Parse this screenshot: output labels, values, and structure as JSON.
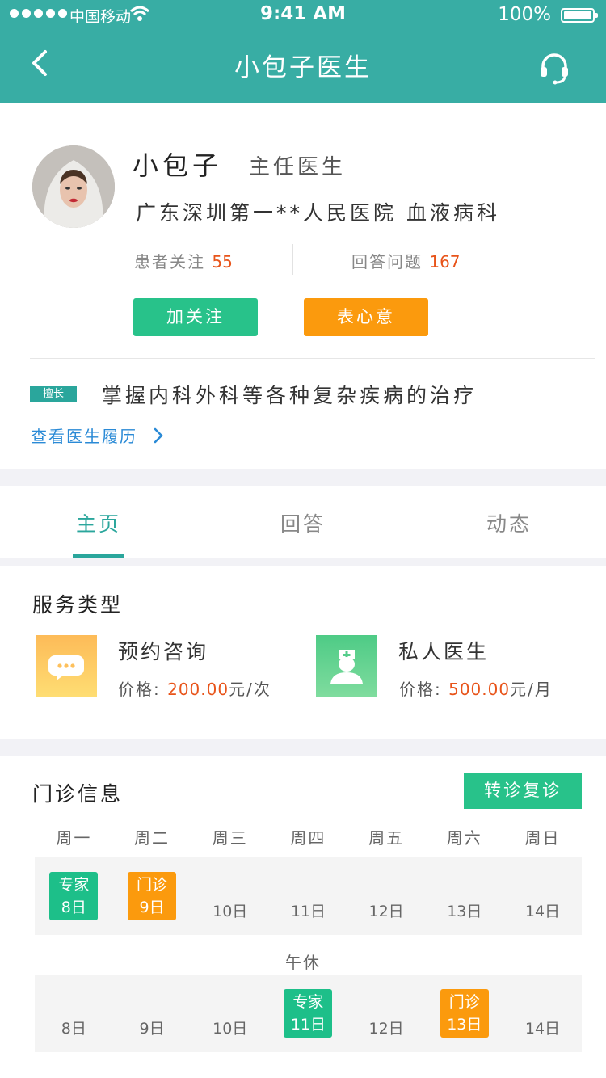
{
  "status_bar": {
    "carrier": "中国移动",
    "time": "9:41 AM",
    "battery": "100%"
  },
  "header": {
    "title": "小包子医生"
  },
  "doctor": {
    "name": "小包子",
    "title": "主任医生",
    "hospital": "广东深圳第一**人民医院  血液病科",
    "followers_label": "患者关注",
    "followers": "55",
    "answers_label": "回答问题",
    "answers": "167",
    "follow_button": "加关注",
    "gift_button": "表心意",
    "specialty_badge": "擅长",
    "specialty": "掌握内科外科等各种复杂疾病的治疗",
    "resume_link": "查看医生履历"
  },
  "tabs": [
    {
      "label": "主页"
    },
    {
      "label": "回答"
    },
    {
      "label": "动态"
    }
  ],
  "services": {
    "title": "服务类型",
    "items": [
      {
        "name": "预约咨询",
        "price_label": "价格:",
        "price": "200.00",
        "unit": "元/次"
      },
      {
        "name": "私人医生",
        "price_label": "价格:",
        "price": "500.00",
        "unit": "元/月"
      }
    ]
  },
  "clinic": {
    "title": "门诊信息",
    "transfer_button": "转诊复诊",
    "weekdays": [
      "周一",
      "周二",
      "周三",
      "周四",
      "周五",
      "周六",
      "周日"
    ],
    "noon_break": "午休",
    "morning": [
      {
        "tag": "专家",
        "day": "8日",
        "type": "green"
      },
      {
        "tag": "门诊",
        "day": "9日",
        "type": "orange"
      },
      {
        "tag": "",
        "day": "10日",
        "type": ""
      },
      {
        "tag": "",
        "day": "11日",
        "type": ""
      },
      {
        "tag": "",
        "day": "12日",
        "type": ""
      },
      {
        "tag": "",
        "day": "13日",
        "type": ""
      },
      {
        "tag": "",
        "day": "14日",
        "type": ""
      }
    ],
    "afternoon": [
      {
        "tag": "",
        "day": "8日",
        "type": ""
      },
      {
        "tag": "",
        "day": "9日",
        "type": ""
      },
      {
        "tag": "",
        "day": "10日",
        "type": ""
      },
      {
        "tag": "专家",
        "day": "11日",
        "type": "green"
      },
      {
        "tag": "",
        "day": "12日",
        "type": ""
      },
      {
        "tag": "门诊",
        "day": "13日",
        "type": "orange"
      },
      {
        "tag": "",
        "day": "14日",
        "type": ""
      }
    ]
  },
  "colors": {
    "header": "#38ada4",
    "accent_green": "#28c28a",
    "accent_orange": "#fb9a0d",
    "highlight": "#e8541a",
    "link": "#2a8ad6"
  }
}
